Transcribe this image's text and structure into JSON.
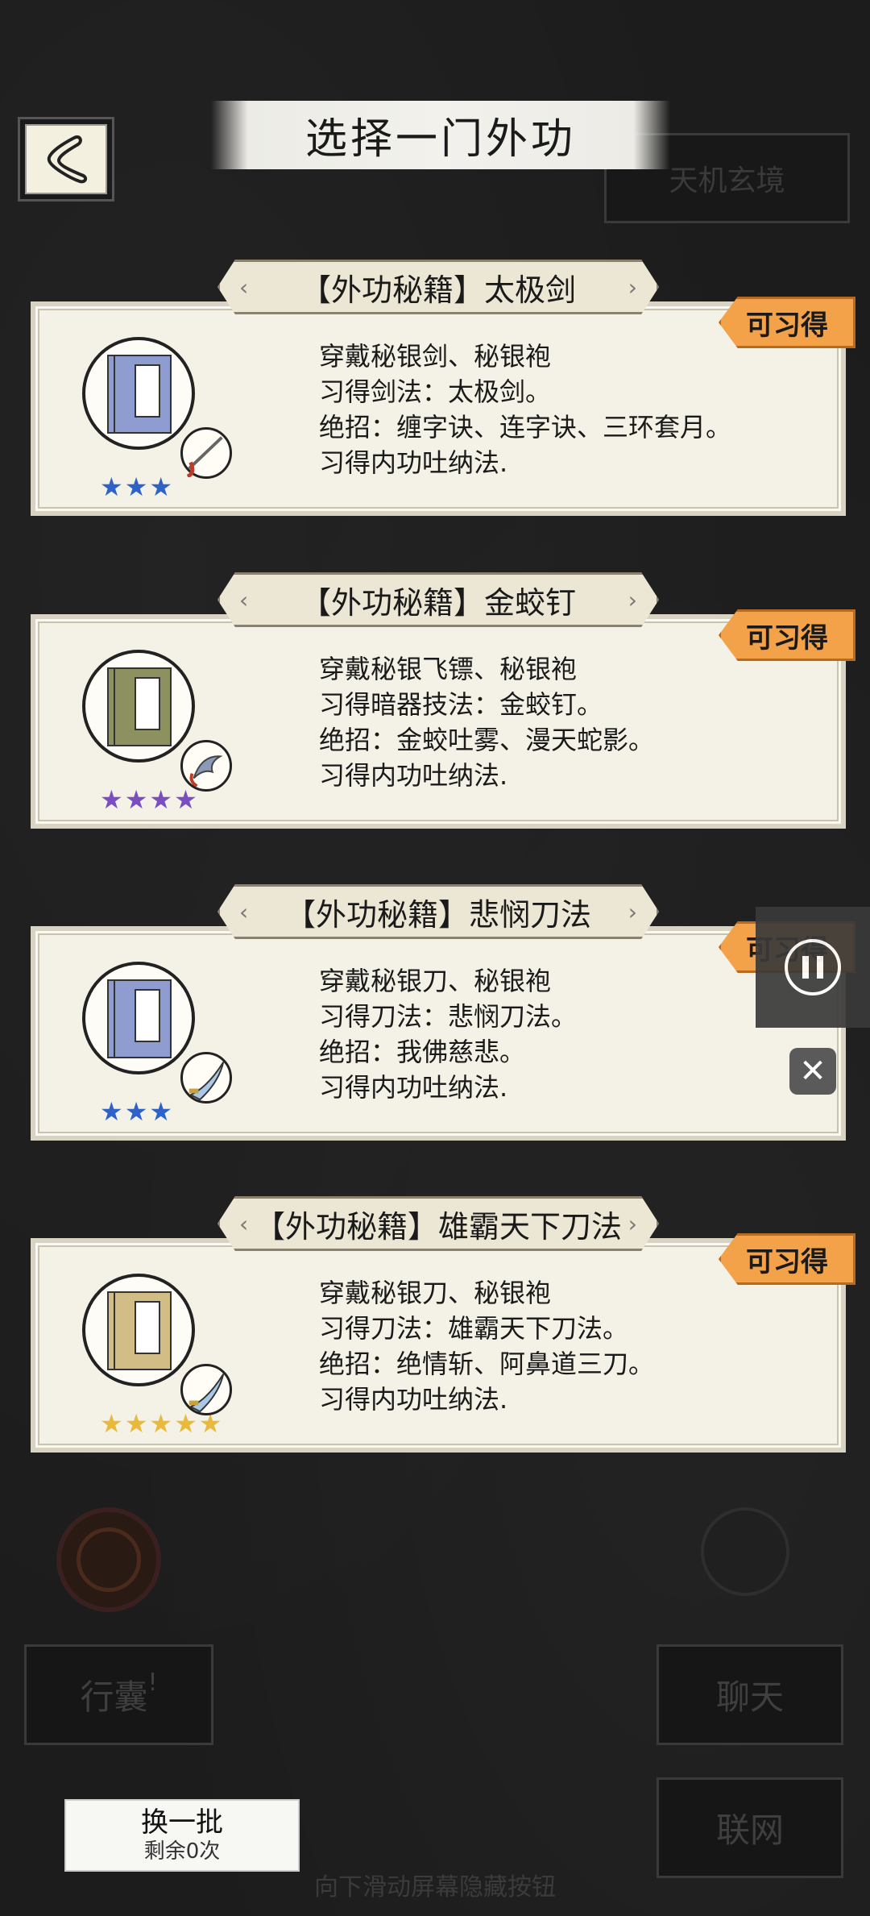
{
  "title": "选择一门外功",
  "top_right_button": "天机玄境",
  "learn_tag": "可习得",
  "cards": [
    {
      "header": "【外功秘籍】太极剑",
      "book_color": "#8e9cd0",
      "stars": "★★★",
      "star_color": "#2f62c8",
      "lines": [
        "穿戴秘银剑、秘银袍",
        "习得剑法：太极剑。",
        "绝招：缠字诀、连字诀、三环套月。",
        "习得内功吐纳法."
      ]
    },
    {
      "header": "【外功秘籍】金蛟钉",
      "book_color": "#8d9160",
      "stars": "★★★★",
      "star_color": "#7a4ec0",
      "lines": [
        "穿戴秘银飞镖、秘银袍",
        "习得暗器技法：金蛟钉。",
        "绝招：金蛟吐雾、漫天蛇影。",
        "习得内功吐纳法."
      ]
    },
    {
      "header": "【外功秘籍】悲悯刀法",
      "book_color": "#8e9cd0",
      "stars": "★★★",
      "star_color": "#2f62c8",
      "lines": [
        "穿戴秘银刀、秘银袍",
        "习得刀法：悲悯刀法。",
        "绝招：我佛慈悲。",
        "习得内功吐纳法."
      ]
    },
    {
      "header": "【外功秘籍】雄霸天下刀法",
      "book_color": "#d2bd86",
      "stars": "★★★★★",
      "star_color": "#e8b93a",
      "lines": [
        "穿戴秘银刀、秘银袍",
        "习得刀法：雄霸天下刀法。",
        "绝招：绝情斩、阿鼻道三刀。",
        "习得内功吐纳法."
      ]
    }
  ],
  "bg_buttons": {
    "bag": "行囊",
    "bag_mark": "!",
    "chat": "聊天",
    "online": "联网"
  },
  "refresh": {
    "label": "换一批",
    "remaining": "剩余0次"
  },
  "hint": "向下滑动屏幕隐藏按钮"
}
